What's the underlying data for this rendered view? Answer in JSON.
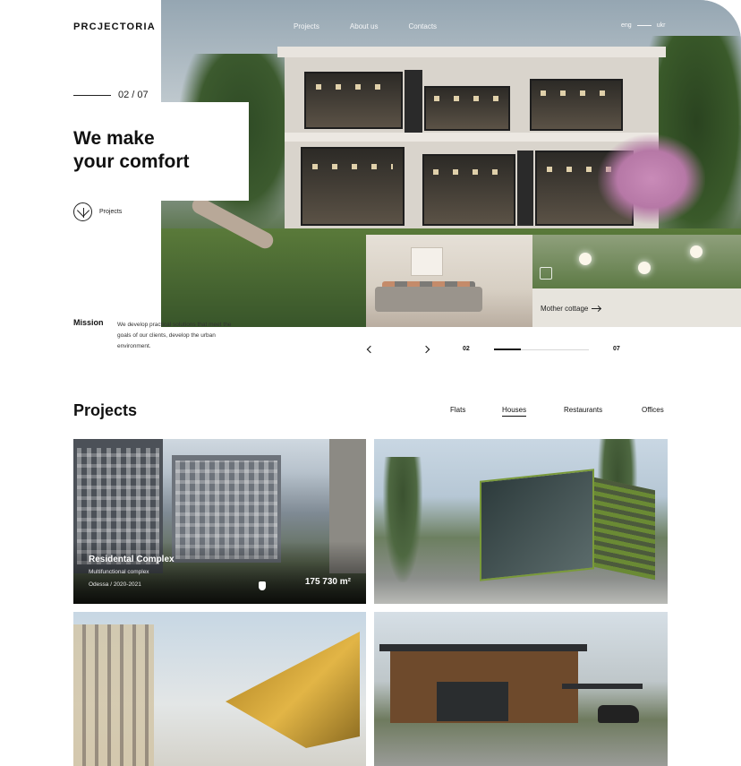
{
  "header": {
    "logo": "PRCJECTORIA",
    "nav": [
      "Projects",
      "About us",
      "Contacts"
    ],
    "lang": {
      "active": "eng",
      "other": "ukr"
    }
  },
  "hero": {
    "counter": "02 / 07",
    "heading": "We make\nyour comfort",
    "projects_link": "Projects",
    "thumb_caption": "Mother cottage",
    "slider": {
      "current": "02",
      "total": "07",
      "progress": 0.28
    }
  },
  "mission": {
    "label": "Mission",
    "text": "We develop practical solutions that meet the goals of our clients, develop the urban environment."
  },
  "projects": {
    "title": "Projects",
    "filters": [
      "Flats",
      "Houses",
      "Restaurants",
      "Offices"
    ],
    "active_filter": "Houses",
    "cards": [
      {
        "name": "Residental Complex",
        "type": "Multifunctional complex",
        "location": "Odessa / 2020-2021",
        "area": "175 730 m²"
      }
    ]
  },
  "icons": [
    "leaf-circle-icon",
    "expand-icon",
    "arrow-right-icon",
    "chevron-left-icon",
    "chevron-right-icon",
    "cursor-icon"
  ]
}
